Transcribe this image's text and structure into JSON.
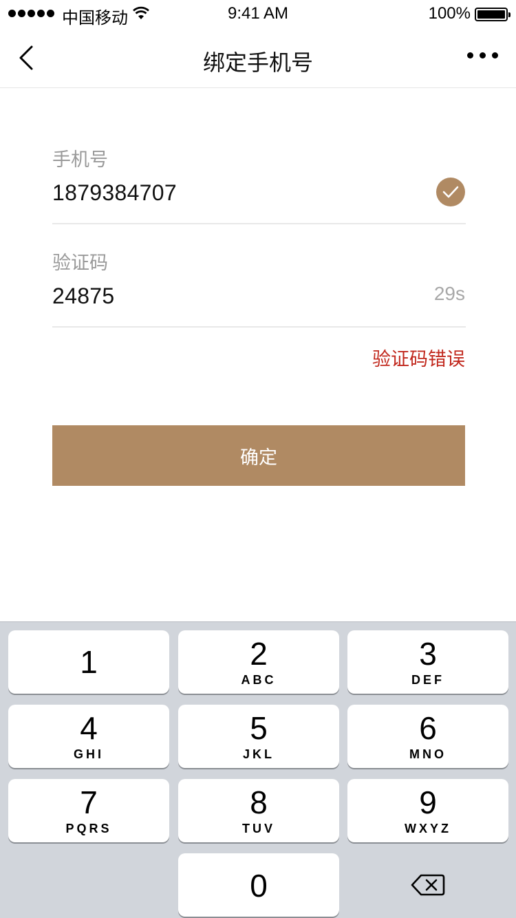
{
  "status_bar": {
    "carrier": "中国移动",
    "time": "9:41 AM",
    "battery": "100%"
  },
  "nav": {
    "title": "绑定手机号",
    "back_icon": "chevron-left-icon",
    "more_icon": "more-dots-icon"
  },
  "form": {
    "phone": {
      "label": "手机号",
      "value": "1879384707",
      "status_icon": "check-circle-icon"
    },
    "code": {
      "label": "验证码",
      "value": "24875",
      "countdown": "29s"
    },
    "error_message": "验证码错误",
    "confirm_label": "确定"
  },
  "keypad": {
    "keys": [
      {
        "num": "1",
        "letters": ""
      },
      {
        "num": "2",
        "letters": "ABC"
      },
      {
        "num": "3",
        "letters": "DEF"
      },
      {
        "num": "4",
        "letters": "GHI"
      },
      {
        "num": "5",
        "letters": "JKL"
      },
      {
        "num": "6",
        "letters": "MNO"
      },
      {
        "num": "7",
        "letters": "PQRS"
      },
      {
        "num": "8",
        "letters": "TUV"
      },
      {
        "num": "9",
        "letters": "WXYZ"
      },
      {
        "num": "0",
        "letters": ""
      }
    ],
    "delete_icon": "backspace-icon"
  },
  "colors": {
    "accent": "#b08a63",
    "error": "#c1271c",
    "keypad_bg": "#d1d5db"
  }
}
